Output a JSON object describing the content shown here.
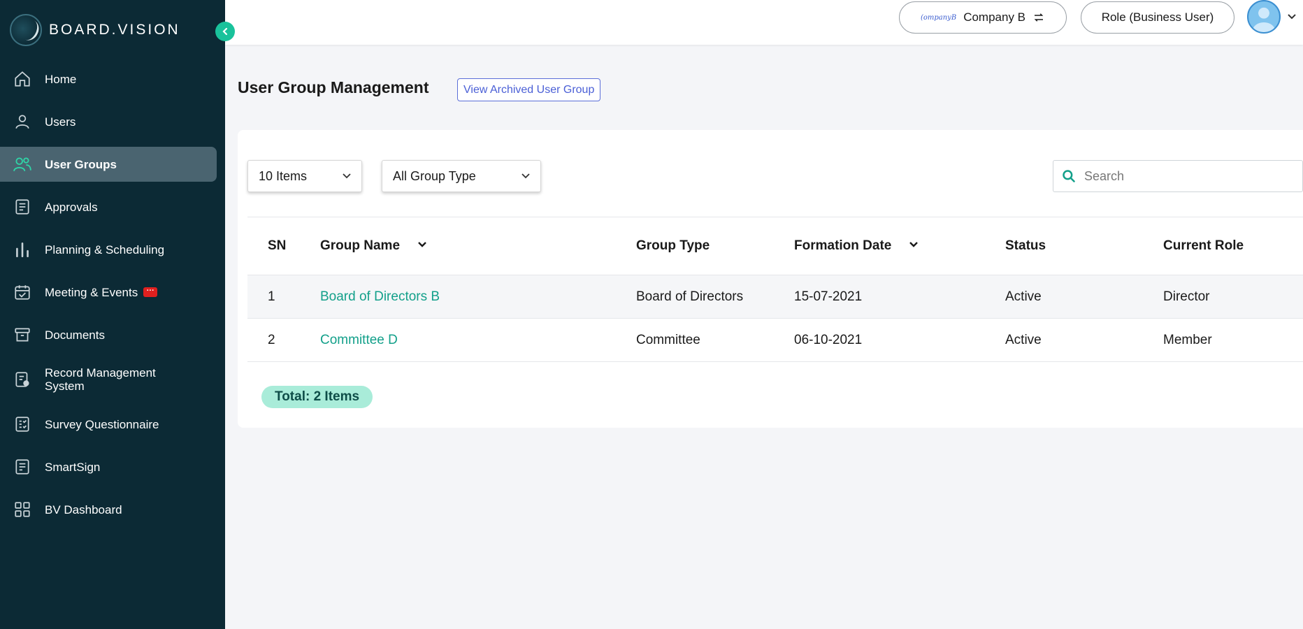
{
  "app": {
    "brand": "BOARD.VISION"
  },
  "sidebar": {
    "items": [
      {
        "label": "Home",
        "icon": "home-icon"
      },
      {
        "label": "Users",
        "icon": "user-icon"
      },
      {
        "label": "User Groups",
        "icon": "users-icon",
        "active": true
      },
      {
        "label": "Approvals",
        "icon": "document-icon"
      },
      {
        "label": "Planning & Scheduling",
        "icon": "bar-chart-icon"
      },
      {
        "label": "Meeting & Events",
        "icon": "calendar-check-icon",
        "badge": "chat-badge-icon"
      },
      {
        "label": "Documents",
        "icon": "archive-icon"
      },
      {
        "label": "Record Management System",
        "icon": "record-search-icon"
      },
      {
        "label": "Survey Questionnaire",
        "icon": "checklist-icon"
      },
      {
        "label": "SmartSign",
        "icon": "sign-document-icon"
      },
      {
        "label": "BV Dashboard",
        "icon": "grid-icon"
      }
    ]
  },
  "header": {
    "company_logo_text": "(ompanyB",
    "company_label": "Company B",
    "role_label": "Role (Business User)"
  },
  "main": {
    "title": "User Group Management",
    "archived_button": "View Archived User Group",
    "items_select": "10 Items",
    "group_type_select": "All Group Type",
    "search_placeholder": "Search",
    "columns": [
      "SN",
      "Group Name",
      "Group Type",
      "Formation Date",
      "Status",
      "Current Role"
    ],
    "rows": [
      {
        "sn": "1",
        "name": "Board of Directors B",
        "type": "Board of Directors",
        "date": "15-07-2021",
        "status": "Active",
        "role": "Director"
      },
      {
        "sn": "2",
        "name": "Committee D",
        "type": "Committee",
        "date": "06-10-2021",
        "status": "Active",
        "role": "Member"
      }
    ],
    "total": "Total: 2 Items"
  },
  "colors": {
    "sidebar_bg": "#0c2a35",
    "active_item_bg": "#4a6470",
    "accent_green": "#19c29b",
    "link_teal": "#13a08a",
    "archived_blue": "#4a5fd6",
    "total_badge_bg": "#a9ecd9"
  }
}
